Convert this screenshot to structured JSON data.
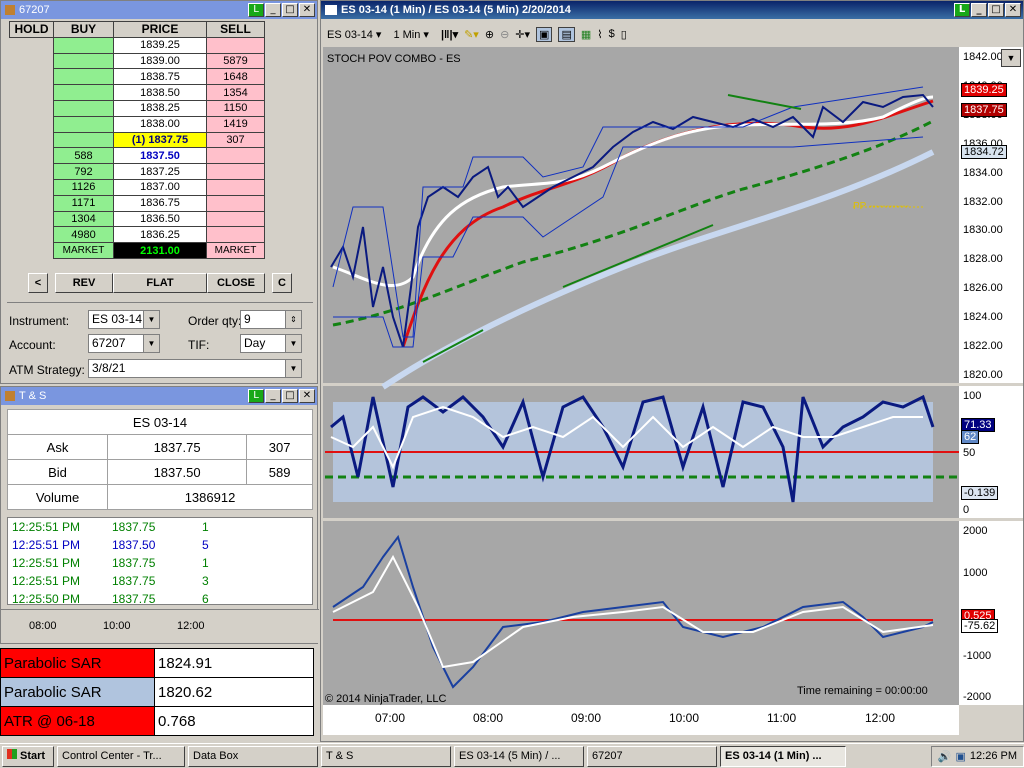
{
  "dom_window": {
    "title": "67207",
    "headers": [
      "HOLD",
      "BUY",
      "PRICE",
      "SELL"
    ],
    "rows": [
      {
        "buy": "",
        "price": "1839.25",
        "sell": ""
      },
      {
        "buy": "",
        "price": "1839.00",
        "sell": "5879"
      },
      {
        "buy": "",
        "price": "1838.75",
        "sell": "1648"
      },
      {
        "buy": "",
        "price": "1838.50",
        "sell": "1354"
      },
      {
        "buy": "",
        "price": "1838.25",
        "sell": "1150"
      },
      {
        "buy": "",
        "price": "1838.00",
        "sell": "1419"
      },
      {
        "buy": "",
        "price": "(1) 1837.75",
        "sell": "307"
      },
      {
        "buy": "588",
        "price": "1837.50",
        "sell": ""
      },
      {
        "buy": "792",
        "price": "1837.25",
        "sell": ""
      },
      {
        "buy": "1126",
        "price": "1837.00",
        "sell": ""
      },
      {
        "buy": "1171",
        "price": "1836.75",
        "sell": ""
      },
      {
        "buy": "1304",
        "price": "1836.50",
        "sell": ""
      },
      {
        "buy": "4980",
        "price": "1836.25",
        "sell": ""
      }
    ],
    "market_buy": "MARKET",
    "market_price": "2131.00",
    "market_sell": "MARKET",
    "btn_left": "<",
    "btn_rev": "REV",
    "btn_flat": "FLAT",
    "btn_close": "CLOSE",
    "btn_c": "C",
    "instrument_label": "Instrument:",
    "instrument_value": "ES 03-14",
    "orderqty_label": "Order qty:",
    "orderqty_value": "9",
    "account_label": "Account:",
    "account_value": "67207",
    "tif_label": "TIF:",
    "tif_value": "Day",
    "atm_label": "ATM Strategy:",
    "atm_value": "3/8/21"
  },
  "ts_window": {
    "title": "T & S",
    "instrument": "ES 03-14",
    "ask_label": "Ask",
    "ask_price": "1837.75",
    "ask_size": "307",
    "bid_label": "Bid",
    "bid_price": "1837.50",
    "bid_size": "589",
    "volume_label": "Volume",
    "volume_value": "1386912",
    "trades": [
      {
        "time": "12:25:51 PM",
        "price": "1837.75",
        "size": "1",
        "color": "#008000"
      },
      {
        "time": "12:25:51 PM",
        "price": "1837.50",
        "size": "5",
        "color": "#0000c0"
      },
      {
        "time": "12:25:51 PM",
        "price": "1837.75",
        "size": "1",
        "color": "#008000"
      },
      {
        "time": "12:25:51 PM",
        "price": "1837.75",
        "size": "3",
        "color": "#008000"
      },
      {
        "time": "12:25:50 PM",
        "price": "1837.75",
        "size": "6",
        "color": "#008000"
      }
    ],
    "time_axis": [
      "08:00",
      "10:00",
      "12:00"
    ]
  },
  "data_box": [
    {
      "label": "Parabolic SAR",
      "value": "1824.91",
      "color": "#ff0000"
    },
    {
      "label": "Parabolic SAR",
      "value": "1820.62",
      "color": "#b0c4de"
    },
    {
      "label": "ATR @ 06-18",
      "value": "0.768",
      "color": "#ff0000"
    }
  ],
  "chart_window": {
    "title": "ES 03-14 (1 Min) / ES 03-14 (5 Min)  2/20/2014",
    "toolbar_instrument": "ES 03-14",
    "toolbar_interval": "1 Min",
    "indicator_label": "STOCH POV COMBO - ES",
    "copyright": "© 2014 NinjaTrader, LLC",
    "time_remaining": "Time remaining = 00:00:00",
    "price_ticks": [
      "1842.00",
      "1840.00",
      "1838.00",
      "1836.00",
      "1834.00",
      "1832.00",
      "1830.00",
      "1828.00",
      "1826.00",
      "1824.00",
      "1822.00",
      "1820.00"
    ],
    "price_tags": [
      {
        "text": "1839.25",
        "bg": "#e00000",
        "fg": "#fff"
      },
      {
        "text": "1837.75",
        "bg": "#b00000",
        "fg": "#fff"
      },
      {
        "text": "1834.72",
        "bg": "#d8e4f0",
        "fg": "#000"
      }
    ],
    "stoch_ticks": [
      "100",
      "50",
      "0"
    ],
    "stoch_tags": [
      {
        "text": "71.33",
        "bg": "#000080",
        "fg": "#fff"
      },
      {
        "text": "62",
        "bg": "#5f87c5",
        "fg": "#fff"
      },
      {
        "text": "-0.139",
        "bg": "#dde6f2",
        "fg": "#000"
      }
    ],
    "osc_ticks": [
      "2000",
      "1000",
      "0",
      "-1000",
      "-2000"
    ],
    "osc_tags": [
      {
        "text": "0.525",
        "bg": "#e00000",
        "fg": "#fff"
      },
      {
        "text": "-75.62",
        "bg": "#fff",
        "fg": "#000"
      }
    ],
    "time_labels": [
      "07:00",
      "08:00",
      "09:00",
      "10:00",
      "11:00",
      "12:00"
    ],
    "pp_label": "PP ------------"
  },
  "taskbar": {
    "start": "Start",
    "items": [
      "Control Center - Tr...",
      "Data Box",
      "T & S",
      "ES 03-14 (5 Min) / ...",
      "67207",
      "ES 03-14 (1 Min) ..."
    ],
    "clock": "12:26 PM"
  }
}
